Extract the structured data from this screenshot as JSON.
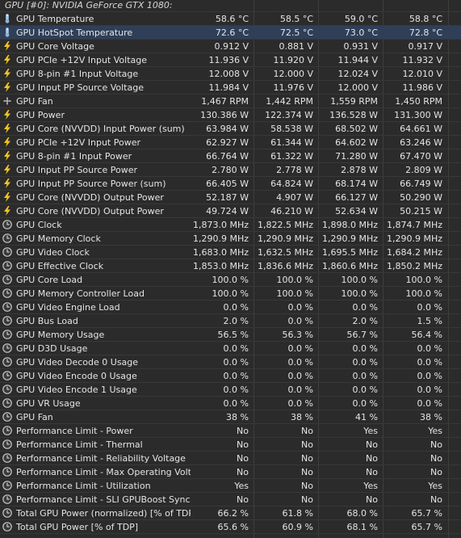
{
  "header": "GPU [#0]: NVIDIA GeForce GTX 1080:",
  "icon_colors": {
    "temp": "#8fb3d9",
    "bolt": "#f2c51f",
    "fan": "#b9b9b9",
    "clock": "#c8c8c8"
  },
  "rows": [
    {
      "icon": "thermometer-icon",
      "label": "GPU Temperature",
      "v": [
        "58.6 °C",
        "58.5 °C",
        "59.0 °C",
        "58.8 °C"
      ]
    },
    {
      "icon": "thermometer-icon",
      "label": "GPU HotSpot Temperature",
      "v": [
        "72.6 °C",
        "72.5 °C",
        "73.0 °C",
        "72.8 °C"
      ],
      "selected": true
    },
    {
      "icon": "lightning-icon",
      "label": "GPU Core Voltage",
      "v": [
        "0.912 V",
        "0.881 V",
        "0.931 V",
        "0.917 V"
      ]
    },
    {
      "icon": "lightning-icon",
      "label": "GPU PCIe +12V Input Voltage",
      "v": [
        "11.936 V",
        "11.920 V",
        "11.944 V",
        "11.932 V"
      ]
    },
    {
      "icon": "lightning-icon",
      "label": "GPU 8-pin #1 Input Voltage",
      "v": [
        "12.008 V",
        "12.000 V",
        "12.024 V",
        "12.010 V"
      ]
    },
    {
      "icon": "lightning-icon",
      "label": "GPU Input PP Source Voltage",
      "v": [
        "11.984 V",
        "11.976 V",
        "12.000 V",
        "11.986 V"
      ]
    },
    {
      "icon": "fan-icon",
      "label": "GPU Fan",
      "v": [
        "1,467 RPM",
        "1,442 RPM",
        "1,559 RPM",
        "1,450 RPM"
      ]
    },
    {
      "icon": "lightning-icon",
      "label": "GPU Power",
      "v": [
        "130.386 W",
        "122.374 W",
        "136.528 W",
        "131.300 W"
      ]
    },
    {
      "icon": "lightning-icon",
      "label": "GPU Core (NVVDD) Input Power (sum)",
      "v": [
        "63.984 W",
        "58.538 W",
        "68.502 W",
        "64.661 W"
      ]
    },
    {
      "icon": "lightning-icon",
      "label": "GPU PCIe +12V Input Power",
      "v": [
        "62.927 W",
        "61.344 W",
        "64.602 W",
        "63.246 W"
      ]
    },
    {
      "icon": "lightning-icon",
      "label": "GPU 8-pin #1 Input Power",
      "v": [
        "66.764 W",
        "61.322 W",
        "71.280 W",
        "67.470 W"
      ]
    },
    {
      "icon": "lightning-icon",
      "label": "GPU Input PP Source Power",
      "v": [
        "2.780 W",
        "2.778 W",
        "2.878 W",
        "2.809 W"
      ]
    },
    {
      "icon": "lightning-icon",
      "label": "GPU Input PP Source Power (sum)",
      "v": [
        "66.405 W",
        "64.824 W",
        "68.174 W",
        "66.749 W"
      ]
    },
    {
      "icon": "lightning-icon",
      "label": "GPU Core (NVVDD) Output Power",
      "v": [
        "52.187 W",
        "4.907 W",
        "66.127 W",
        "50.290 W"
      ]
    },
    {
      "icon": "lightning-icon",
      "label": "GPU Core (NVVDD) Output Power",
      "v": [
        "49.724 W",
        "46.210 W",
        "52.634 W",
        "50.215 W"
      ]
    },
    {
      "icon": "clock-icon",
      "label": "GPU Clock",
      "v": [
        "1,873.0 MHz",
        "1,822.5 MHz",
        "1,898.0 MHz",
        "1,874.7 MHz"
      ]
    },
    {
      "icon": "clock-icon",
      "label": "GPU Memory Clock",
      "v": [
        "1,290.9 MHz",
        "1,290.9 MHz",
        "1,290.9 MHz",
        "1,290.9 MHz"
      ]
    },
    {
      "icon": "clock-icon",
      "label": "GPU Video Clock",
      "v": [
        "1,683.0 MHz",
        "1,632.5 MHz",
        "1,695.5 MHz",
        "1,684.2 MHz"
      ]
    },
    {
      "icon": "clock-icon",
      "label": "GPU Effective Clock",
      "v": [
        "1,853.0 MHz",
        "1,836.6 MHz",
        "1,860.6 MHz",
        "1,850.2 MHz"
      ]
    },
    {
      "icon": "clock-icon",
      "label": "GPU Core Load",
      "v": [
        "100.0 %",
        "100.0 %",
        "100.0 %",
        "100.0 %"
      ]
    },
    {
      "icon": "clock-icon",
      "label": "GPU Memory Controller Load",
      "v": [
        "100.0 %",
        "100.0 %",
        "100.0 %",
        "100.0 %"
      ]
    },
    {
      "icon": "clock-icon",
      "label": "GPU Video Engine Load",
      "v": [
        "0.0 %",
        "0.0 %",
        "0.0 %",
        "0.0 %"
      ]
    },
    {
      "icon": "clock-icon",
      "label": "GPU Bus Load",
      "v": [
        "2.0 %",
        "0.0 %",
        "2.0 %",
        "1.5 %"
      ]
    },
    {
      "icon": "clock-icon",
      "label": "GPU Memory Usage",
      "v": [
        "56.5 %",
        "56.3 %",
        "56.7 %",
        "56.4 %"
      ]
    },
    {
      "icon": "clock-icon",
      "label": "GPU D3D Usage",
      "v": [
        "0.0 %",
        "0.0 %",
        "0.0 %",
        "0.0 %"
      ]
    },
    {
      "icon": "clock-icon",
      "label": "GPU Video Decode 0 Usage",
      "v": [
        "0.0 %",
        "0.0 %",
        "0.0 %",
        "0.0 %"
      ]
    },
    {
      "icon": "clock-icon",
      "label": "GPU Video Encode 0 Usage",
      "v": [
        "0.0 %",
        "0.0 %",
        "0.0 %",
        "0.0 %"
      ]
    },
    {
      "icon": "clock-icon",
      "label": "GPU Video Encode 1 Usage",
      "v": [
        "0.0 %",
        "0.0 %",
        "0.0 %",
        "0.0 %"
      ]
    },
    {
      "icon": "clock-icon",
      "label": "GPU VR Usage",
      "v": [
        "0.0 %",
        "0.0 %",
        "0.0 %",
        "0.0 %"
      ]
    },
    {
      "icon": "clock-icon",
      "label": "GPU Fan",
      "v": [
        "38 %",
        "38 %",
        "41 %",
        "38 %"
      ]
    },
    {
      "icon": "clock-icon",
      "label": "Performance Limit - Power",
      "v": [
        "No",
        "No",
        "Yes",
        "Yes"
      ]
    },
    {
      "icon": "clock-icon",
      "label": "Performance Limit - Thermal",
      "v": [
        "No",
        "No",
        "No",
        "No"
      ]
    },
    {
      "icon": "clock-icon",
      "label": "Performance Limit - Reliability Voltage",
      "v": [
        "No",
        "No",
        "No",
        "No"
      ]
    },
    {
      "icon": "clock-icon",
      "label": "Performance Limit - Max Operating Voltage",
      "v": [
        "No",
        "No",
        "No",
        "No"
      ]
    },
    {
      "icon": "clock-icon",
      "label": "Performance Limit - Utilization",
      "v": [
        "Yes",
        "No",
        "Yes",
        "Yes"
      ]
    },
    {
      "icon": "clock-icon",
      "label": "Performance Limit - SLI GPUBoost Sync",
      "v": [
        "No",
        "No",
        "No",
        "No"
      ]
    },
    {
      "icon": "clock-icon",
      "label": "Total GPU Power (normalized) [% of TDP]",
      "v": [
        "66.2 %",
        "61.8 %",
        "68.0 %",
        "65.7 %"
      ]
    },
    {
      "icon": "clock-icon",
      "label": "Total GPU Power [% of TDP]",
      "v": [
        "65.6 %",
        "60.9 %",
        "68.1 %",
        "65.7 %"
      ]
    }
  ]
}
